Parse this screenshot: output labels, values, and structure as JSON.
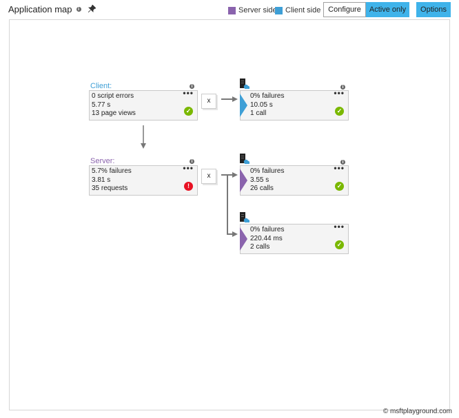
{
  "header": {
    "title": "Application map",
    "info_icon": "info-icon",
    "pin_icon": "pin-icon"
  },
  "legend": {
    "server_label": "Server side",
    "server_color": "#8a63ad",
    "client_label": "Client side",
    "client_color": "#3e9fd6"
  },
  "toolbar": {
    "configure_label": "Configure",
    "active_only_label": "Active only",
    "options_label": "Options"
  },
  "nodes": {
    "client": {
      "label": "Client:",
      "lines": [
        "0 script errors",
        "5.77 s",
        "13 page views"
      ],
      "status": "ok"
    },
    "server": {
      "label": "Server:",
      "lines": [
        "5.7% failures",
        "3.81 s",
        "35 requests"
      ],
      "status": "error"
    },
    "dep1": {
      "lines": [
        "0% failures",
        "10.05 s",
        "1 call"
      ],
      "status": "ok"
    },
    "dep2": {
      "lines": [
        "0% failures",
        "3.55 s",
        "26 calls"
      ],
      "status": "ok"
    },
    "dep3": {
      "lines": [
        "0% failures",
        "220.44 ms",
        "2 calls"
      ],
      "status": "ok"
    }
  },
  "connectors": {
    "client_x": "x",
    "server_x": "x"
  },
  "more_label": "•••",
  "status_ok_glyph": "✓",
  "status_error_glyph": "!",
  "info_glyph": "i",
  "footer": {
    "copyright": "© msftplayground.com"
  }
}
